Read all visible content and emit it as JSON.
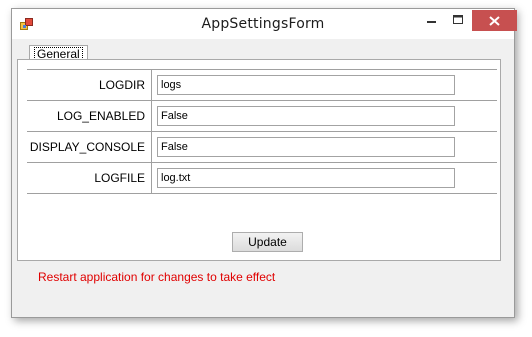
{
  "window": {
    "title": "AppSettingsForm"
  },
  "tabs": [
    {
      "label": "General",
      "selected": true
    }
  ],
  "settings": {
    "rows": [
      {
        "key": "LOGDIR",
        "value": "logs"
      },
      {
        "key": "LOG_ENABLED",
        "value": "False"
      },
      {
        "key": "DISPLAY_CONSOLE",
        "value": "False"
      },
      {
        "key": "LOGFILE",
        "value": "log.txt"
      }
    ]
  },
  "actions": {
    "update_label": "Update"
  },
  "status": {
    "message": "Restart application for changes to take effect",
    "color": "#e00000"
  },
  "icons": {
    "app": "app-icon",
    "minimize": "minimize-icon",
    "maximize": "maximize-icon",
    "close": "close-icon"
  },
  "colors": {
    "close_button": "#c75050",
    "window_bg": "#f0f0f0"
  }
}
